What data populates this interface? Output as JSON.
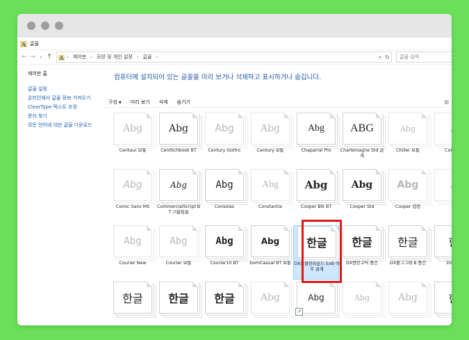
{
  "window": {
    "title": "글꼴"
  },
  "address": {
    "crumbs": [
      "제어판",
      "모양 및 개인 설정",
      "글꼴"
    ],
    "search_placeholder": "글꼴 검색"
  },
  "sidebar": {
    "home": "제어판 홈",
    "links": [
      "글꼴 설정",
      "온라인에서 글꼴 정보 가져오기",
      "ClearType 텍스트 조정",
      "문자 찾기",
      "모든 언어에 대한 글꼴 다운로드"
    ]
  },
  "headline": "컴퓨터에 설치되어 있는 글꼴을 미리 보거나 삭제하고 표시하거나 숨깁니다.",
  "toolbar": {
    "organize": "구성",
    "preview": "미리 보기",
    "delete": "삭제",
    "hide": "숨기기"
  },
  "fonts": [
    {
      "sample": "Abg",
      "label": "Centaur 보통"
    },
    {
      "sample": "Abg",
      "label": "CentSchbook BT"
    },
    {
      "sample": "Abg",
      "label": "Century Gothic"
    },
    {
      "sample": "Abg",
      "label": "Century 보통"
    },
    {
      "sample": "Abg",
      "label": "Chaparral Pro"
    },
    {
      "sample": "ABG",
      "label": "Charlemagne Std 굵게"
    },
    {
      "sample": "Abg",
      "label": "Chiller 보통"
    },
    {
      "sample": "A",
      "label": "Colon 통"
    },
    {
      "sample": "Abg",
      "label": "Comic Sans MS"
    },
    {
      "sample": "Abg",
      "label": "CommercialScript BT 기울임꼴"
    },
    {
      "sample": "Abg",
      "label": "Consolas"
    },
    {
      "sample": "Abg",
      "label": "Constantia"
    },
    {
      "sample": "Abg",
      "label": "Cooper Blk BT"
    },
    {
      "sample": "Abg",
      "label": "Cooper Std"
    },
    {
      "sample": "Abg",
      "label": "Cooper 검정"
    },
    {
      "sample": "A",
      "label": ""
    },
    {
      "sample": "Abg",
      "label": "Courier New"
    },
    {
      "sample": "Abg",
      "label": "Courier 보통"
    },
    {
      "sample": "Abg",
      "label": "Courier10 BT"
    },
    {
      "sample": "Abg",
      "label": "DomCasual BT 보통"
    },
    {
      "sample": "한글",
      "label": "DX르블란라운드 ExB 아주 굵게"
    },
    {
      "sample": "한글",
      "label": "DX방탄고딕 중간"
    },
    {
      "sample": "한글",
      "label": "DX볼그그래 B 중간"
    },
    {
      "sample": "한",
      "label": "DX시인"
    },
    {
      "sample": "한글",
      "label": ""
    },
    {
      "sample": "한글",
      "label": ""
    },
    {
      "sample": "한글",
      "label": ""
    },
    {
      "sample": "Abg",
      "label": ""
    },
    {
      "sample": "Abg",
      "label": ""
    },
    {
      "sample": "Abg",
      "label": ""
    },
    {
      "sample": "Abg",
      "label": ""
    },
    {
      "sample": "한",
      "label": ""
    }
  ]
}
